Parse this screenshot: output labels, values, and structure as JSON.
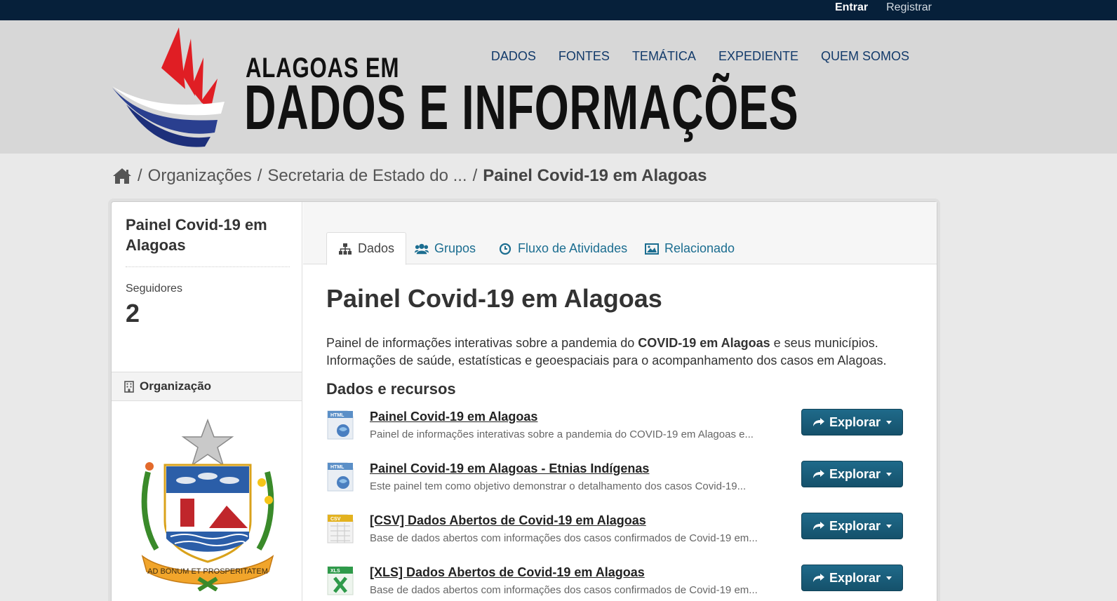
{
  "account": {
    "login": "Entrar",
    "register": "Registrar"
  },
  "logo": {
    "line1": "ALAGOAS EM",
    "line2": "DADOS E INFORMAÇÕES"
  },
  "nav": [
    "DADOS",
    "FONTES",
    "TEMÁTICA",
    "EXPEDIENTE",
    "QUEM SOMOS"
  ],
  "breadcrumb": {
    "items": [
      "Organizações",
      "Secretaria de Estado do ..."
    ],
    "current": "Painel Covid-19 em Alagoas",
    "separator": "/"
  },
  "sidebar": {
    "title": "Painel Covid-19 em Alagoas",
    "followers_label": "Seguidores",
    "followers_count": "2",
    "org_heading": "Organização",
    "crest_motto": "AD BONUM ET PROSPERITATEM"
  },
  "tabs": [
    {
      "label": "Dados",
      "icon": "sitemap-icon",
      "active": true
    },
    {
      "label": "Grupos",
      "icon": "users-icon",
      "active": false
    },
    {
      "label": "Fluxo de Atividades",
      "icon": "clock-icon",
      "active": false
    },
    {
      "label": "Relacionado",
      "icon": "picture-icon",
      "active": false
    }
  ],
  "dataset": {
    "title": "Painel Covid-19 em Alagoas",
    "desc_pre": "Painel de informações interativas sobre a pandemia do ",
    "desc_bold": "COVID-19 em Alagoas",
    "desc_post": " e seus municípios. Informações de saúde, estatísticas e geoespaciais para o acompanhamento dos casos em Alagoas.",
    "resources_heading": "Dados e recursos"
  },
  "resources": [
    {
      "format": "HTML",
      "title": "Painel Covid-19 em Alagoas",
      "desc": "Painel de informações interativas sobre a pandemia do COVID-19 em Alagoas e..."
    },
    {
      "format": "HTML",
      "title": "Painel Covid-19 em Alagoas - Etnias Indígenas",
      "desc": "Este painel tem como objetivo demonstrar o detalhamento dos casos Covid-19..."
    },
    {
      "format": "CSV",
      "title": "[CSV] Dados Abertos de Covid-19 em Alagoas",
      "desc": "Base de dados abertos com informações dos casos confirmados de Covid-19 em..."
    },
    {
      "format": "XLS",
      "title": "[XLS] Dados Abertos de Covid-19 em Alagoas",
      "desc": "Base de dados abertos com informações dos casos confirmados de Covid-19 em..."
    }
  ],
  "explore_label": "Explorar",
  "colors": {
    "topbar": "#06203a",
    "nav_link": "#123a6a",
    "tab_link": "#1b6d90",
    "button": "#1a5f7d"
  }
}
